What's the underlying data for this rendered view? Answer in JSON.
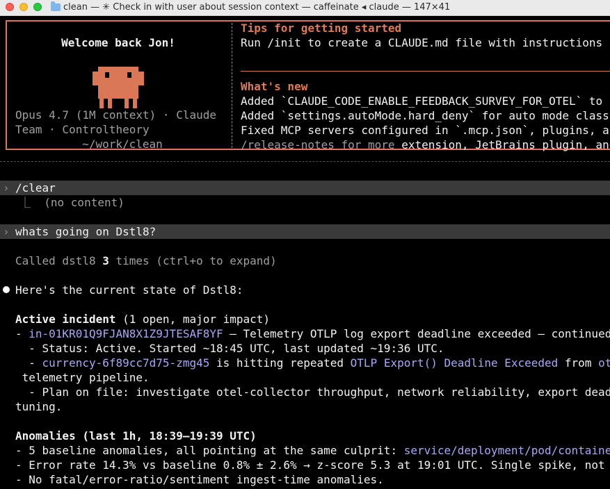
{
  "window": {
    "title": "clean — ✳ Check in with user about session context — caffeinate ◂ claude — 147×41"
  },
  "colors": {
    "accent": "#d97757",
    "link": "#a9a7f8",
    "prompt_bg": "#3a3a3a"
  },
  "welcome": {
    "greeting": "Welcome back Jon!",
    "model_line": "Opus 4.7 (1M context) · Claude",
    "team_line": "Team · Controltheory",
    "cwd": "~/work/clean"
  },
  "tips": {
    "heading": "Tips for getting started",
    "line1": "Run /init to create a CLAUDE.md file with instructions f"
  },
  "whats_new": {
    "heading": "What's new",
    "items": [
      "Added `CLAUDE_CODE_ENABLE_FEEDBACK_SURVEY_FOR_OTEL` to r",
      "Added `settings.autoMode.hard_deny` for auto mode classi",
      "Fixed MCP servers configured in `.mcp.json`, plugins, ar"
    ],
    "release_notes": "/release-notes for more",
    "release_notes_tail": " extension, JetBrains plugin, and"
  },
  "transcript": {
    "cmd1": "/clear",
    "cmd1_result": "⎿  (no content)",
    "cmd2": "whats going on Dstl8?",
    "called_prefix": "Called dstl8 ",
    "called_count": "3",
    "called_suffix": " times (ctrl+o to expand)",
    "answer_intro": "Here's the current state of Dstl8:",
    "incident_heading": "Active incident",
    "incident_meta": " (1 open, major impact)",
    "incident_id": "in-01KR01Q9FJAN8X1Z9JTESAF8YF",
    "incident_title": " — Telemetry OTLP log export deadline exceeded — continued",
    "status_line": "  - Status: Active. Started ~18:45 UTC, last updated ~19:36 UTC.",
    "svc_name": "currency-6f89cc7d75-zmg45",
    "svc_mid": " is hitting repeated ",
    "svc_error": "OTLP Export() Deadline Exceeded",
    "svc_from": " from ",
    "svc_tail": "otl",
    "pipeline_line": " telemetry pipeline.",
    "plan_line": "  - Plan on file: investigate otel-collector throughput, network reliability, export deadl",
    "tuning_line": "tuning.",
    "anomalies_heading": "Anomalies (last 1h, 18:39–19:39 UTC)",
    "anom1_prefix": "- 5 baseline anomalies, all pointing at the same culprit: ",
    "anom1_link": "service/deployment/pod/container",
    "anom2": "- Error rate 14.3% vs baseline 0.8% ± 2.6% → z-score 5.3 at 19:01 UTC. Single spike, not d",
    "anom3": "- No fatal/error-ratio/sentiment ingest-time anomalies."
  }
}
